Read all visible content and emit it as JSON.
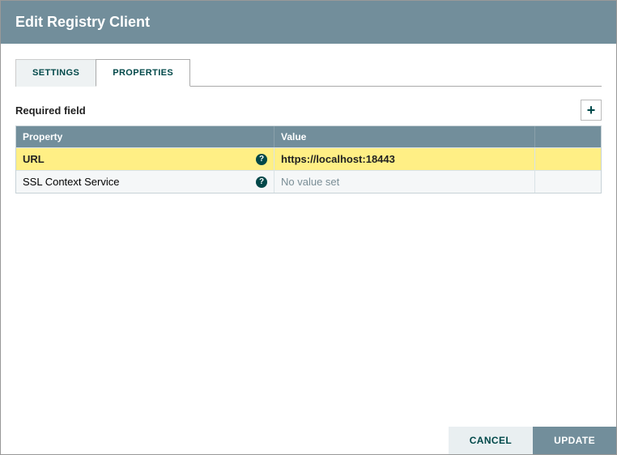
{
  "dialog": {
    "title": "Edit Registry Client"
  },
  "tabs": {
    "settings": "SETTINGS",
    "properties": "PROPERTIES"
  },
  "required_field_label": "Required field",
  "add_button_text": "+",
  "grid": {
    "header": {
      "property": "Property",
      "value": "Value"
    },
    "rows": [
      {
        "name": "URL",
        "value": "https://localhost:18443",
        "empty": false,
        "selected": true
      },
      {
        "name": "SSL Context Service",
        "value": "No value set",
        "empty": true,
        "selected": false
      }
    ]
  },
  "help_glyph": "?",
  "footer": {
    "cancel": "CANCEL",
    "update": "UPDATE"
  }
}
